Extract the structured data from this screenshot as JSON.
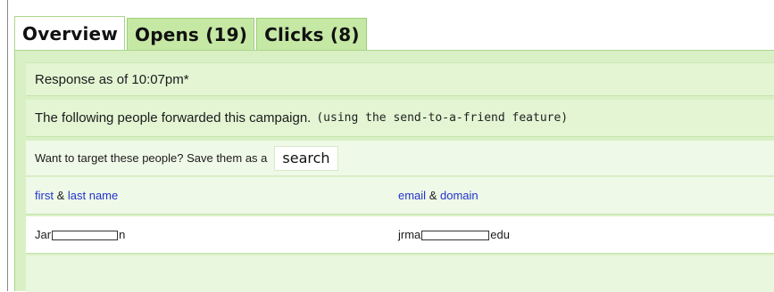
{
  "tabs": [
    {
      "label": "Overview",
      "active": true
    },
    {
      "label": "Opens (19)",
      "active": false
    },
    {
      "label": "Clicks (8)",
      "active": false
    }
  ],
  "response": {
    "text": "Response as of 10:07pm*"
  },
  "forwarded": {
    "text": "The following people forwarded this campaign.",
    "note": "(using the send-to-a-friend feature)"
  },
  "target": {
    "text": "Want to target these people? Save them as a",
    "button_label": "search"
  },
  "table": {
    "columns": [
      {
        "part1": "first",
        "amp": "&",
        "part2": "last name"
      },
      {
        "part1": "email",
        "amp": "&",
        "part2": "domain"
      }
    ],
    "rows": [
      {
        "name_prefix": "Jar",
        "name_suffix": "n",
        "email_prefix": "jrma",
        "email_suffix": "edu"
      }
    ]
  },
  "colors": {
    "tab_green": "#c6e8a5",
    "panel_green": "#d9f0c5",
    "link_blue": "#2233cc"
  }
}
